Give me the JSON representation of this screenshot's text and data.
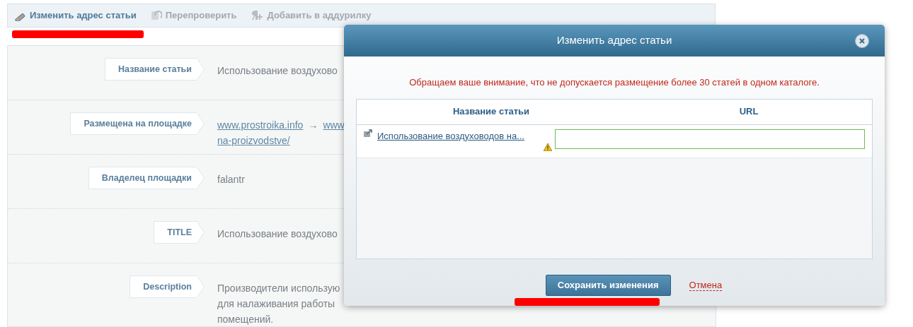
{
  "toolbar": [
    {
      "label": "Изменить адрес статьи",
      "disabled": false
    },
    {
      "label": "Перепроверить",
      "disabled": true
    },
    {
      "label": "Добавить в аддурилку",
      "disabled": true
    }
  ],
  "details": [
    {
      "label": "Название статьи",
      "value": [
        [
          "Использование воздухово"
        ]
      ]
    },
    {
      "label": "Размещена на площадке",
      "links": [
        [
          "www.prostroika.info",
          "→",
          "www"
        ],
        [
          "na-proizvodstve/"
        ]
      ]
    },
    {
      "label": "Владелец площадки",
      "value": [
        [
          "falantr"
        ]
      ]
    },
    {
      "label": "TITLE",
      "value": [
        [
          "Использование воздухово"
        ]
      ]
    },
    {
      "label": "Description",
      "value": [
        [
          "Производители использую"
        ],
        [
          "для налаживания работы"
        ],
        [
          "помещений."
        ]
      ]
    }
  ],
  "dialog": {
    "title": "Изменить адрес статьи",
    "notice": "Обращаем ваше внимание, что не допускается размещение более 30 статей в одном каталоге.",
    "columns": [
      "Название статьи",
      "URL"
    ],
    "rows": [
      {
        "article": "Использование воздуховодов на...",
        "warning": true
      }
    ],
    "save_button": "Сохранить изменения",
    "cancel_link": "Отмена"
  }
}
